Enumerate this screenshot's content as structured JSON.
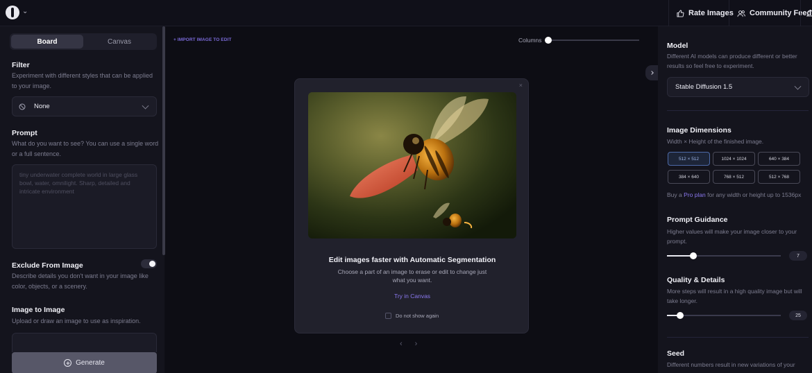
{
  "topbar": {
    "rate_images": "Rate Images",
    "community_feed": "Community Feed"
  },
  "left": {
    "tabs": [
      {
        "label": "Board",
        "active": true
      },
      {
        "label": "Canvas",
        "active": false
      }
    ],
    "filter": {
      "title": "Filter",
      "description": "Experiment with different styles that can be applied to your image.",
      "value": "None"
    },
    "prompt": {
      "title": "Prompt",
      "description": "What do you want to see? You can use a single word or a full sentence.",
      "placeholder": "tiny underwater complete world in large glass bowl, water, omnilight. Sharp, detailed and intricate environment"
    },
    "exclude": {
      "title": "Exclude From Image",
      "description": "Describe details you don't want in your image like color, objects, or a scenery.",
      "enabled": true
    },
    "image_to_image": {
      "title": "Image to Image",
      "description": "Upload or draw an image to use as inspiration."
    },
    "generate_label": "Generate"
  },
  "center": {
    "import_label": "+ IMPORT IMAGE TO EDIT",
    "columns_label": "Columns",
    "modal": {
      "close": "×",
      "title": "Edit images faster with Automatic Segmentation",
      "description": "Choose a part of an image to erase or edit to change just what you want.",
      "link": "Try in Canvas",
      "checkbox_label": "Do not show again"
    },
    "pager": {
      "prev": "‹",
      "next": "›"
    }
  },
  "right": {
    "model": {
      "title": "Model",
      "description": "Different AI models can produce different or better results so feel free to experiment.",
      "value": "Stable Diffusion 1.5"
    },
    "dimensions": {
      "title": "Image Dimensions",
      "description": "Width × Height of the finished image.",
      "options": [
        "512 × 512",
        "1024 × 1024",
        "640 × 384",
        "384 × 640",
        "768 × 512",
        "512 × 768"
      ],
      "selected": "512 × 512",
      "pro_prefix": "Buy a",
      "pro_link": "Pro plan",
      "pro_suffix": "for any width or height up to 1536px"
    },
    "guidance": {
      "title": "Prompt Guidance",
      "description": "Higher values will make your image closer to your prompt.",
      "value": "7"
    },
    "quality": {
      "title": "Quality & Details",
      "description": "More steps will result in a high quality image but will take longer.",
      "value": "25"
    },
    "seed": {
      "title": "Seed",
      "description": "Different numbers result in new variations of your"
    }
  },
  "colors": {
    "accent": "#8a78ee",
    "background": "#0d0d14",
    "panel": "#14141d"
  },
  "icons": [
    "app-logo-icon",
    "thumbs-up-icon",
    "users-icon",
    "bell-icon",
    "no-filter-icon",
    "plus-circle-icon",
    "chevron-down-icon",
    "chevron-right-icon"
  ]
}
